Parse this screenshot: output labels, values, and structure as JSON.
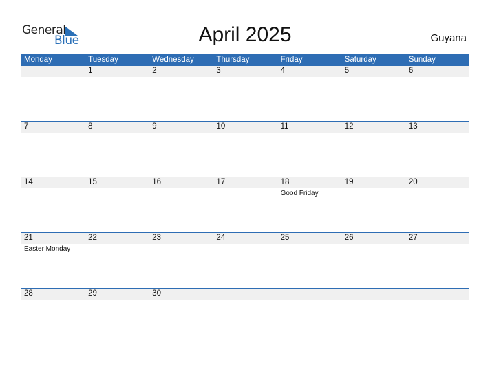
{
  "logo": {
    "line1": "General",
    "line2": "Blue"
  },
  "title": "April 2025",
  "country": "Guyana",
  "weekdays": [
    "Monday",
    "Tuesday",
    "Wednesday",
    "Thursday",
    "Friday",
    "Saturday",
    "Sunday"
  ],
  "weeks": [
    [
      {
        "d": ""
      },
      {
        "d": "1"
      },
      {
        "d": "2"
      },
      {
        "d": "3"
      },
      {
        "d": "4"
      },
      {
        "d": "5"
      },
      {
        "d": "6"
      }
    ],
    [
      {
        "d": "7"
      },
      {
        "d": "8"
      },
      {
        "d": "9"
      },
      {
        "d": "10"
      },
      {
        "d": "11"
      },
      {
        "d": "12"
      },
      {
        "d": "13"
      }
    ],
    [
      {
        "d": "14"
      },
      {
        "d": "15"
      },
      {
        "d": "16"
      },
      {
        "d": "17"
      },
      {
        "d": "18",
        "h": "Good Friday"
      },
      {
        "d": "19"
      },
      {
        "d": "20"
      }
    ],
    [
      {
        "d": "21",
        "h": "Easter Monday"
      },
      {
        "d": "22"
      },
      {
        "d": "23"
      },
      {
        "d": "24"
      },
      {
        "d": "25"
      },
      {
        "d": "26"
      },
      {
        "d": "27"
      }
    ],
    [
      {
        "d": "28"
      },
      {
        "d": "29"
      },
      {
        "d": "30"
      },
      {
        "d": ""
      },
      {
        "d": ""
      },
      {
        "d": ""
      },
      {
        "d": ""
      }
    ]
  ],
  "colors": {
    "accent": "#2e6db4",
    "band": "#f0f0f0"
  }
}
